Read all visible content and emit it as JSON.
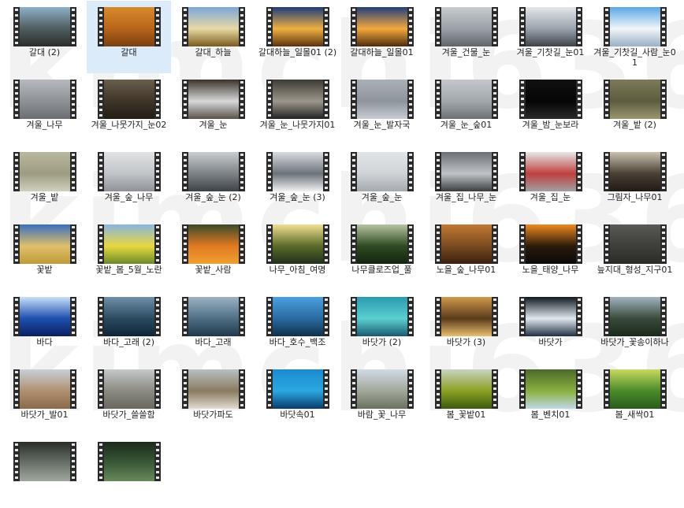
{
  "watermark": {
    "lines": [
      "kimchi636",
      "kimchi636",
      "kimchi636"
    ]
  },
  "selected_index": 1,
  "files": [
    {
      "name": "갈대 (2)",
      "colors": [
        "#8fb0c8",
        "#4d5d60",
        "#2a2d2a"
      ]
    },
    {
      "name": "갈대",
      "colors": [
        "#d98a2c",
        "#b8651a",
        "#7a3f10"
      ]
    },
    {
      "name": "갈대_하늘",
      "colors": [
        "#7ba7d9",
        "#e8d9a4",
        "#7a5a1e"
      ]
    },
    {
      "name": "갈대하늘_일몰01 (2)",
      "colors": [
        "#1c3b7a",
        "#f0b040",
        "#5a3210"
      ]
    },
    {
      "name": "갈대하늘_일몰01",
      "colors": [
        "#223e7c",
        "#f4a93c",
        "#4e2c0e"
      ]
    },
    {
      "name": "겨울_건물_눈",
      "colors": [
        "#c8ccd0",
        "#9aa0a6",
        "#5f6568"
      ]
    },
    {
      "name": "겨울_기찻길_눈01",
      "colors": [
        "#e4e6ea",
        "#9aa3ad",
        "#3d4348"
      ]
    },
    {
      "name": "겨울_기찻길_사람_눈01",
      "colors": [
        "#5aa7e6",
        "#f2f5f8",
        "#9ab0c4"
      ]
    },
    {
      "name": "겨울_나무",
      "colors": [
        "#b6b9bd",
        "#8e9296",
        "#6a6e72"
      ]
    },
    {
      "name": "겨울_나뭇가지_눈02",
      "colors": [
        "#6a5e4c",
        "#3e3528",
        "#221c14"
      ]
    },
    {
      "name": "겨울_눈",
      "colors": [
        "#3a332b",
        "#d8d8d8",
        "#5a524a"
      ]
    },
    {
      "name": "겨울_눈_나뭇가지01",
      "colors": [
        "#3d3a34",
        "#9c968c",
        "#222"
      ]
    },
    {
      "name": "겨울_눈_발자국",
      "colors": [
        "#a9b0b8",
        "#8d949c",
        "#c6ccd2"
      ]
    },
    {
      "name": "겨울_눈_숲01",
      "colors": [
        "#c3c7cc",
        "#a3a8ae",
        "#6b7075"
      ]
    },
    {
      "name": "겨울_밤_눈보라",
      "colors": [
        "#111",
        "#050505",
        "#2a2a2a"
      ]
    },
    {
      "name": "겨울_밭 (2)",
      "colors": [
        "#7c7a58",
        "#5e5c40",
        "#9a9770"
      ]
    },
    {
      "name": "겨울_밭",
      "colors": [
        "#b9b8a0",
        "#9d9c80",
        "#d0d0c0"
      ]
    },
    {
      "name": "겨울_숲_나무",
      "colors": [
        "#e1e3e5",
        "#c0c4c8",
        "#8e9296"
      ]
    },
    {
      "name": "겨울_숲_눈 (2)",
      "colors": [
        "#c9cdd0",
        "#7d8286",
        "#3d4246"
      ]
    },
    {
      "name": "겨울_숲_눈 (3)",
      "colors": [
        "#d8dce0",
        "#6b7379",
        "#f1f2f3"
      ]
    },
    {
      "name": "겨울_숲_눈",
      "colors": [
        "#e2e5e8",
        "#cfd3d7",
        "#a4a9ae"
      ]
    },
    {
      "name": "겨울_집_나무_눈",
      "colors": [
        "#6c6f73",
        "#bfc3c7",
        "#3a3d40"
      ]
    },
    {
      "name": "겨울_집_눈",
      "colors": [
        "#e7e7e7",
        "#c04040",
        "#a0a0a0"
      ]
    },
    {
      "name": "그림자_나무01",
      "colors": [
        "#c9c2b0",
        "#4a4034",
        "#1f1a14"
      ]
    },
    {
      "name": "꽃밭",
      "colors": [
        "#3a6fbf",
        "#e0c06a",
        "#c09a3a"
      ]
    },
    {
      "name": "꽃밭_봄_5월_노란",
      "colors": [
        "#8ab4e0",
        "#e8d840",
        "#6a8a2a"
      ]
    },
    {
      "name": "꽃밭_사람",
      "colors": [
        "#3a4a2a",
        "#e07a20",
        "#f0a030"
      ]
    },
    {
      "name": "나무_아침_여명",
      "colors": [
        "#f0e090",
        "#5a6a2a",
        "#20301a"
      ]
    },
    {
      "name": "나무클로즈업_풀",
      "colors": [
        "#b6c4a2",
        "#2e4a22",
        "#13240e"
      ]
    },
    {
      "name": "노을_숲_나무01",
      "colors": [
        "#c07a30",
        "#7a4a20",
        "#3a2010"
      ]
    },
    {
      "name": "노을_태양_나무",
      "colors": [
        "#f08a20",
        "#2a1a0a",
        "#0a0a0a"
      ]
    },
    {
      "name": "늪지대_형성_지구01",
      "colors": [
        "#5a5a56",
        "#3e3e3a",
        "#2a2a26"
      ]
    },
    {
      "name": "바다",
      "colors": [
        "#c8e0f8",
        "#1e4fb0",
        "#0a2060"
      ]
    },
    {
      "name": "바다_고래 (2)",
      "colors": [
        "#6e90a8",
        "#2a4a60",
        "#0e2436"
      ]
    },
    {
      "name": "바다_고래",
      "colors": [
        "#9ab2c4",
        "#4e6e84",
        "#22384a"
      ]
    },
    {
      "name": "바다_호수_백조",
      "colors": [
        "#4aa0e0",
        "#2a6aa0",
        "#10304a"
      ]
    },
    {
      "name": "바닷가 (2)",
      "colors": [
        "#2a9ab0",
        "#5ad0d0",
        "#1a5a70"
      ]
    },
    {
      "name": "바닷가 (3)",
      "colors": [
        "#d09a4a",
        "#5a3a1a",
        "#e8c070"
      ]
    },
    {
      "name": "바닷가",
      "colors": [
        "#101820",
        "#e0e8f0",
        "#203040"
      ]
    },
    {
      "name": "바닷가_꽃송이하나",
      "colors": [
        "#a0b4c0",
        "#3a4a3a",
        "#1a2a1a"
      ]
    },
    {
      "name": "바닷가_발01",
      "colors": [
        "#c8d0d8",
        "#b09070",
        "#8a6a4a"
      ]
    },
    {
      "name": "바닷가_쓸쓸함",
      "colors": [
        "#c4c8ca",
        "#8a8a80",
        "#6a685e"
      ]
    },
    {
      "name": "바닷가파도",
      "colors": [
        "#b8c0c0",
        "#8a7a60",
        "#e0dcd0"
      ]
    },
    {
      "name": "바닷속01",
      "colors": [
        "#1a8ad0",
        "#2aa8e0",
        "#0a3a6a"
      ]
    },
    {
      "name": "바람_꽃_나무",
      "colors": [
        "#d0dae4",
        "#a0a89a",
        "#6a7060"
      ]
    },
    {
      "name": "봄_꽃밭01",
      "colors": [
        "#c8d4c0",
        "#8aa020",
        "#3a5a10"
      ]
    },
    {
      "name": "봄_벤치01",
      "colors": [
        "#4a6a2a",
        "#8ab040",
        "#c0d8e8"
      ]
    },
    {
      "name": "봄_새싹01",
      "colors": [
        "#c8d860",
        "#4a8a2a",
        "#2a5a1a"
      ]
    },
    {
      "name": "",
      "colors": [
        "#2a2e2a",
        "#6a726a",
        "#a0a8a0"
      ]
    },
    {
      "name": "",
      "colors": [
        "#1a2a1a",
        "#3a5a3a",
        "#6a8a5a"
      ]
    }
  ]
}
